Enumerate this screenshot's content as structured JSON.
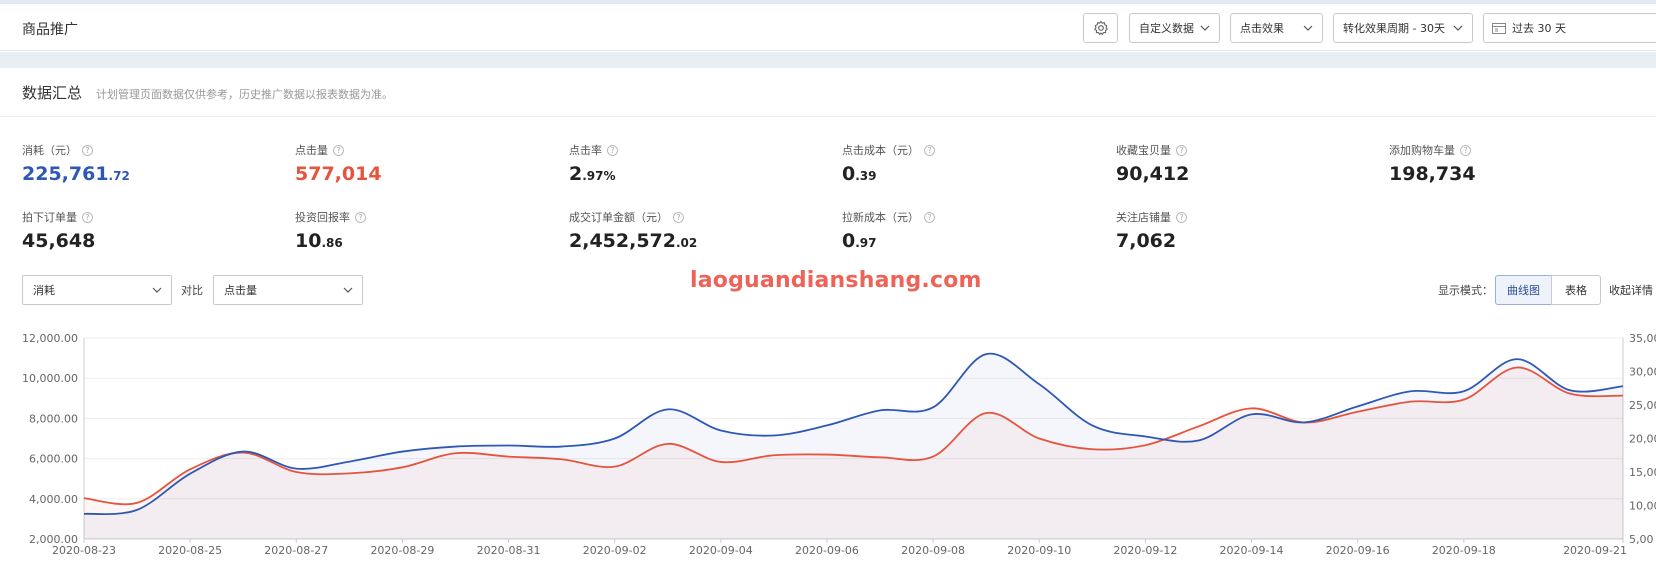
{
  "header": {
    "title": "商品推广",
    "custom_data_label": "自定义数据",
    "click_effect_label": "点击效果",
    "conversion_period_label": "转化效果周期 - 30天",
    "date_range_label": "过去 30 天"
  },
  "summary": {
    "title": "数据汇总",
    "note": "计划管理页面数据仅供参考，历史推广数据以报表数据为准。"
  },
  "metrics": [
    {
      "label": "消耗（元）",
      "int": "225,761",
      "dec": ".72"
    },
    {
      "label": "点击量",
      "int": "577,014",
      "dec": ""
    },
    {
      "label": "点击率",
      "int": "2",
      "dec": ".97%"
    },
    {
      "label": "点击成本（元）",
      "int": "0",
      "dec": ".39"
    },
    {
      "label": "收藏宝贝量",
      "int": "90,412",
      "dec": ""
    },
    {
      "label": "添加购物车量",
      "int": "198,734",
      "dec": ""
    },
    {
      "label": "拍下订单量",
      "int": "45,648",
      "dec": ""
    },
    {
      "label": "投资回报率",
      "int": "10",
      "dec": ".86"
    },
    {
      "label": "成交订单金额（元）",
      "int": "2,452,572",
      "dec": ".02"
    },
    {
      "label": "拉新成本（元）",
      "int": "0",
      "dec": ".97"
    },
    {
      "label": "关注店铺量",
      "int": "7,062",
      "dec": ""
    }
  ],
  "controls": {
    "metric_a": "消耗",
    "compare_label": "对比",
    "metric_b": "点击量",
    "mode_label": "显示模式：",
    "mode_line": "曲线图",
    "mode_table": "表格",
    "collapse": "收起详情"
  },
  "watermark": "laoguandianshang.com",
  "colors": {
    "blue_series": "#2f58b4",
    "red_series": "#e5543c"
  },
  "chart_data": {
    "type": "line",
    "x": [
      "2020-08-23",
      "2020-08-24",
      "2020-08-25",
      "2020-08-26",
      "2020-08-27",
      "2020-08-28",
      "2020-08-29",
      "2020-08-30",
      "2020-08-31",
      "2020-09-01",
      "2020-09-02",
      "2020-09-03",
      "2020-09-04",
      "2020-09-05",
      "2020-09-06",
      "2020-09-07",
      "2020-09-08",
      "2020-09-09",
      "2020-09-10",
      "2020-09-11",
      "2020-09-12",
      "2020-09-13",
      "2020-09-14",
      "2020-09-15",
      "2020-09-16",
      "2020-09-17",
      "2020-09-18",
      "2020-09-19",
      "2020-09-20",
      "2020-09-21"
    ],
    "x_tick_labels": [
      "2020-08-23",
      "2020-08-25",
      "2020-08-27",
      "2020-08-29",
      "2020-08-31",
      "2020-09-02",
      "2020-09-04",
      "2020-09-06",
      "2020-09-08",
      "2020-09-10",
      "2020-09-12",
      "2020-09-14",
      "2020-09-16",
      "2020-09-18",
      "2020-09-21"
    ],
    "y_left": {
      "ticks": [
        "2,000.00",
        "4,000.00",
        "6,000.00",
        "8,000.00",
        "10,000.00",
        "12,000.00"
      ],
      "ylim": [
        2000,
        12000
      ]
    },
    "y_right": {
      "ticks": [
        "5,00",
        "10,00",
        "15,00",
        "20,00",
        "25,00",
        "30,00",
        "35,00"
      ],
      "ylim": [
        5000,
        35000
      ]
    },
    "series": [
      {
        "axis": "left",
        "values": [
          3250,
          3450,
          5250,
          6350,
          5500,
          5850,
          6350,
          6600,
          6650,
          6600,
          7000,
          8450,
          7400,
          7150,
          7650,
          8400,
          8550,
          11200,
          9700,
          7650,
          7100,
          6900,
          8200,
          7800,
          8600,
          9350,
          9350,
          10950,
          9400,
          9600
        ]
      },
      {
        "axis": "right",
        "values": [
          11100,
          10400,
          15400,
          17900,
          15000,
          14800,
          15700,
          17800,
          17300,
          16900,
          15800,
          19200,
          16500,
          17500,
          17600,
          17200,
          17300,
          23800,
          20000,
          18400,
          19000,
          21800,
          24500,
          22400,
          24000,
          25500,
          25800,
          30600,
          26700,
          26400
        ]
      }
    ],
    "grid": true
  }
}
